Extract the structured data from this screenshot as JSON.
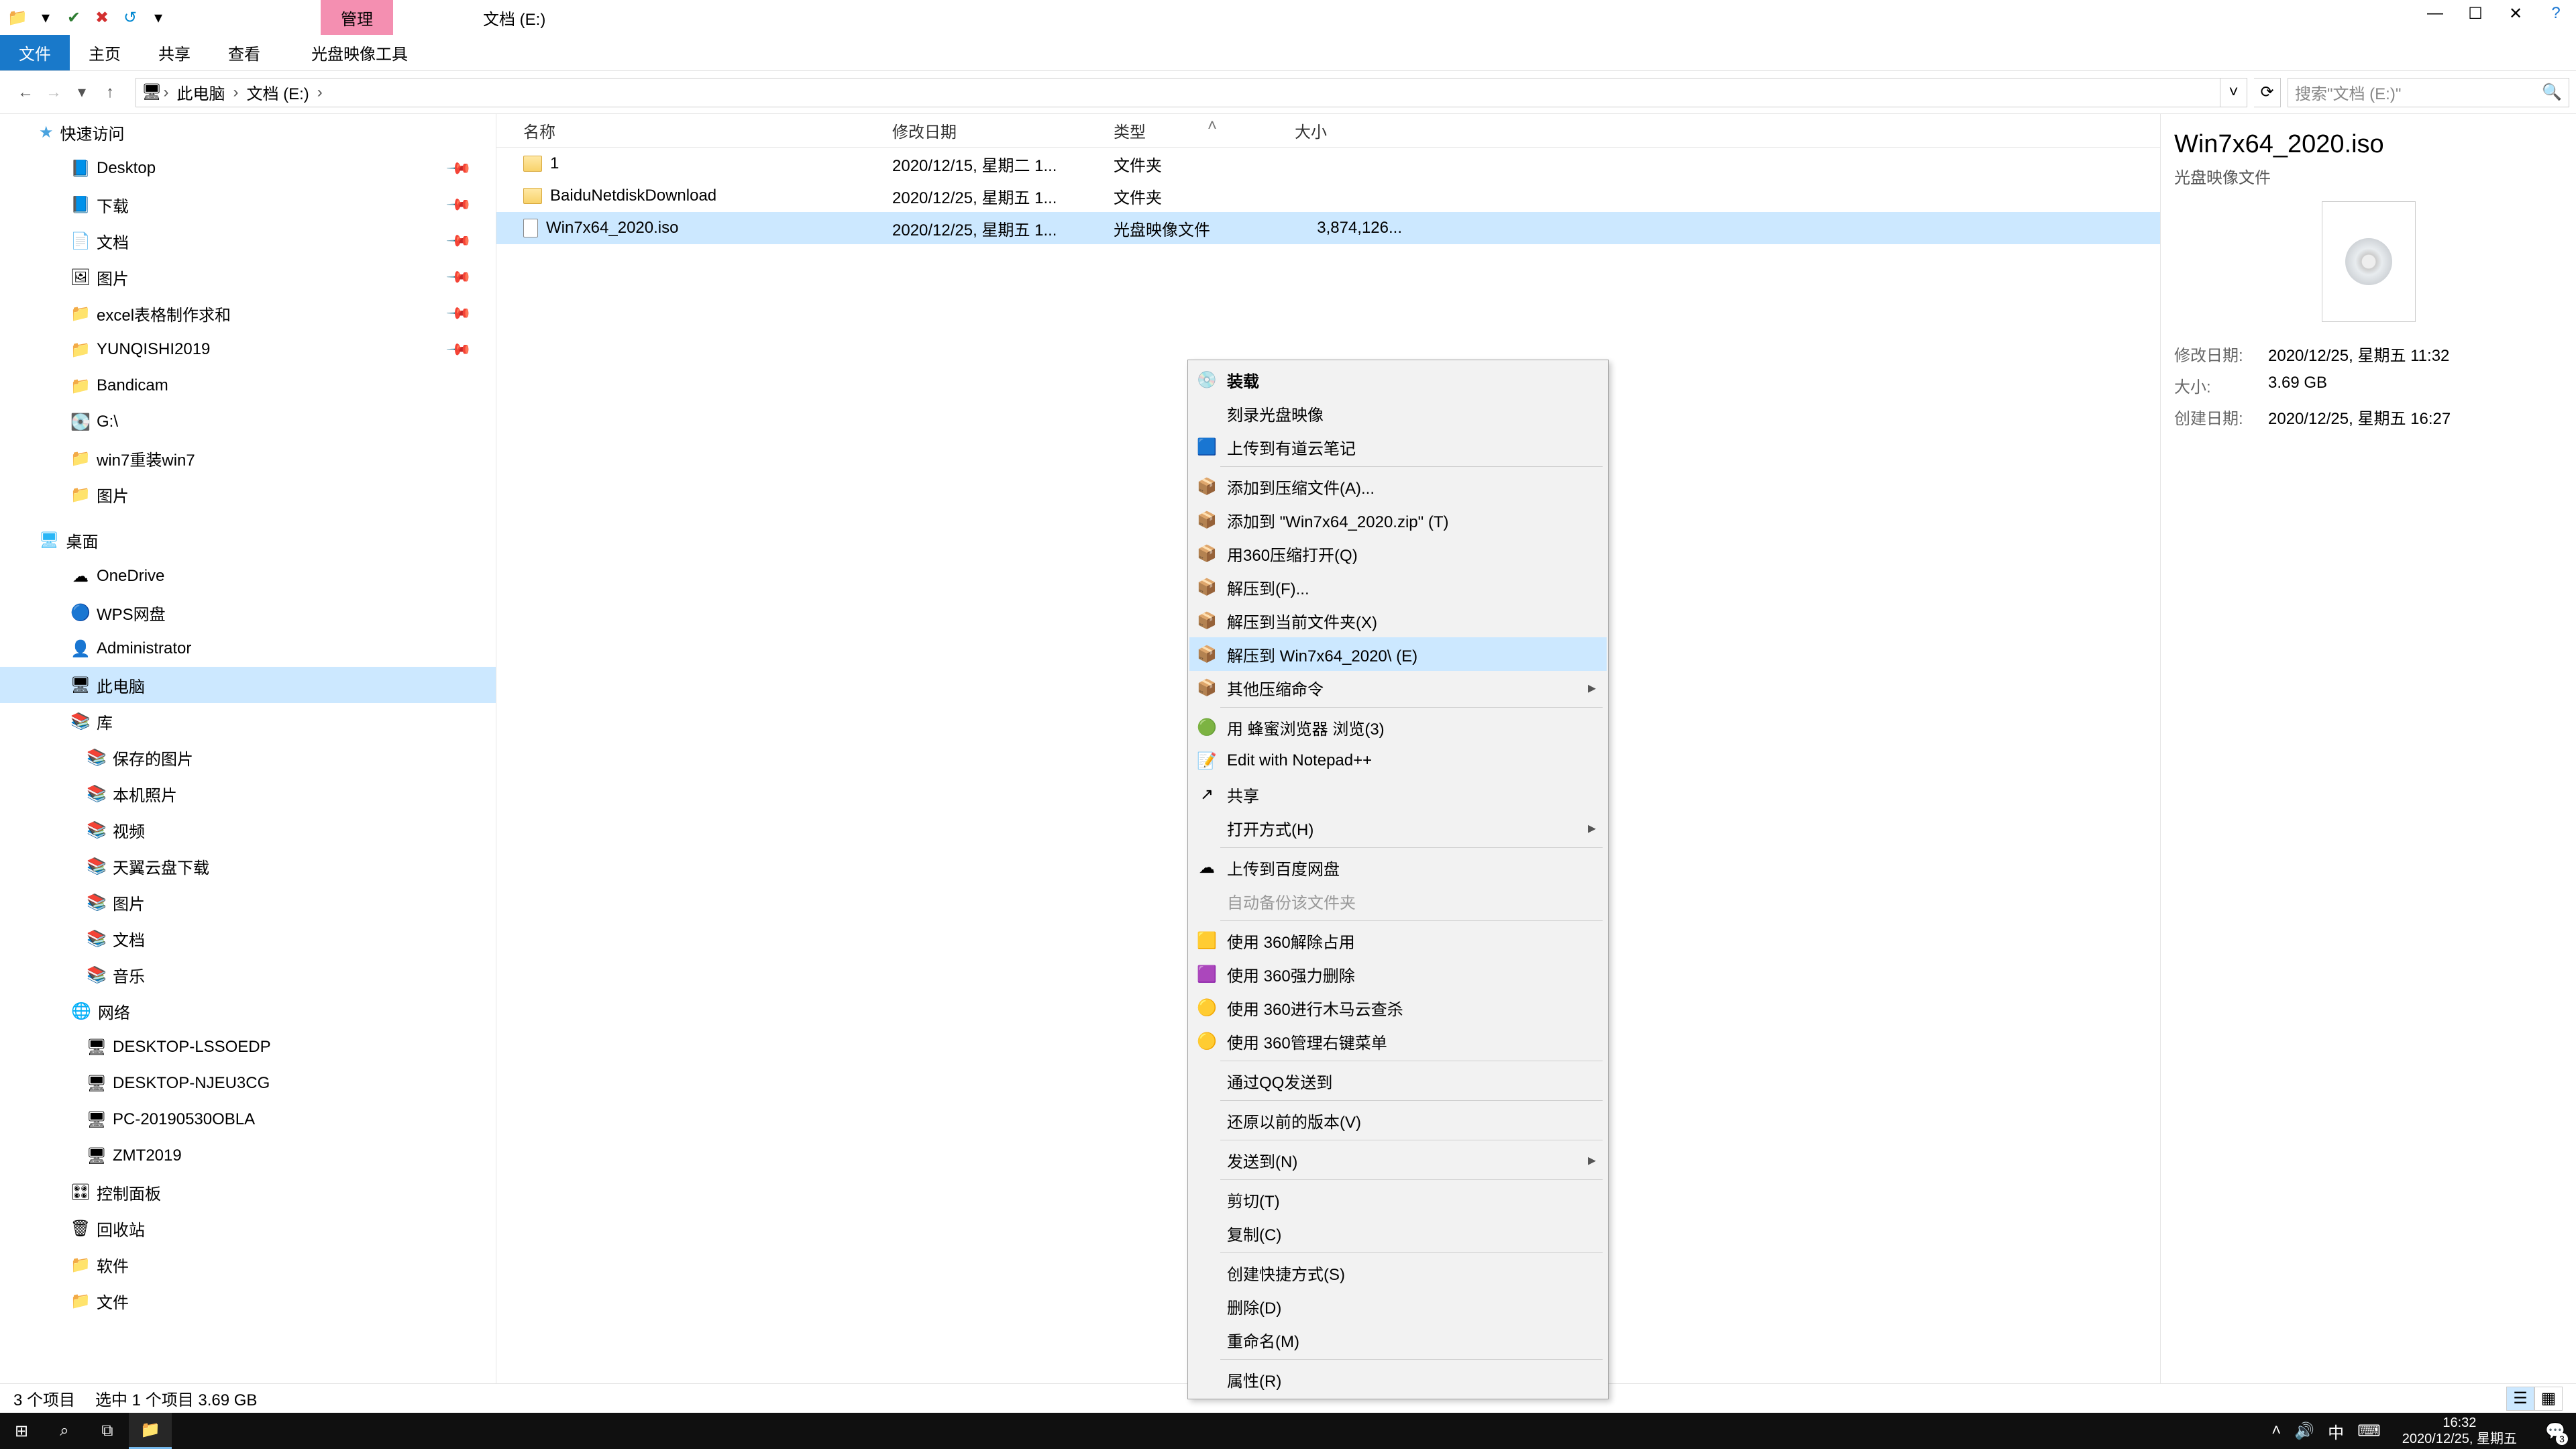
{
  "titlebar": {
    "contextTab": "管理",
    "windowTitle": "文档 (E:)"
  },
  "ribbon": {
    "tabs": [
      "文件",
      "主页",
      "共享",
      "查看",
      "光盘映像工具"
    ]
  },
  "address": {
    "crumbs": [
      "此电脑",
      "文档 (E:)"
    ],
    "searchPlaceholder": "搜索\"文档 (E:)\""
  },
  "nav": {
    "quickAccess": "快速访问",
    "quickItems": [
      {
        "label": "Desktop",
        "pin": true,
        "ic": "📘"
      },
      {
        "label": "下载",
        "pin": true,
        "ic": "📘"
      },
      {
        "label": "文档",
        "pin": true,
        "ic": "📄"
      },
      {
        "label": "图片",
        "pin": true,
        "ic": "🖼"
      },
      {
        "label": "excel表格制作求和",
        "pin": true,
        "ic": "📁"
      },
      {
        "label": "YUNQISHI2019",
        "pin": true,
        "ic": "📁"
      },
      {
        "label": "Bandicam",
        "pin": false,
        "ic": "📁"
      },
      {
        "label": "G:\\",
        "pin": false,
        "ic": "💽"
      },
      {
        "label": "win7重装win7",
        "pin": false,
        "ic": "📁"
      },
      {
        "label": "图片",
        "pin": false,
        "ic": "📁"
      }
    ],
    "desktop": "桌面",
    "desktopItems": [
      {
        "label": "OneDrive",
        "ic": "☁"
      },
      {
        "label": "WPS网盘",
        "ic": "🔵"
      },
      {
        "label": "Administrator",
        "ic": "👤"
      },
      {
        "label": "此电脑",
        "ic": "🖥",
        "selected": true
      },
      {
        "label": "库",
        "ic": "📚"
      }
    ],
    "libraryItems": [
      {
        "label": "保存的图片"
      },
      {
        "label": "本机照片"
      },
      {
        "label": "视频"
      },
      {
        "label": "天翼云盘下载"
      },
      {
        "label": "图片"
      },
      {
        "label": "文档"
      },
      {
        "label": "音乐"
      }
    ],
    "network": "网络",
    "networkItems": [
      {
        "label": "DESKTOP-LSSOEDP"
      },
      {
        "label": "DESKTOP-NJEU3CG"
      },
      {
        "label": "PC-20190530OBLA"
      },
      {
        "label": "ZMT2019"
      }
    ],
    "extras": [
      {
        "label": "控制面板",
        "ic": "🎛"
      },
      {
        "label": "回收站",
        "ic": "🗑"
      },
      {
        "label": "软件",
        "ic": "📁"
      },
      {
        "label": "文件",
        "ic": "📁"
      }
    ]
  },
  "columns": {
    "name": "名称",
    "date": "修改日期",
    "type": "类型",
    "size": "大小"
  },
  "files": [
    {
      "name": "1",
      "date": "2020/12/15, 星期二 1...",
      "type": "文件夹",
      "size": "",
      "ic": "folder"
    },
    {
      "name": "BaiduNetdiskDownload",
      "date": "2020/12/25, 星期五 1...",
      "type": "文件夹",
      "size": "",
      "ic": "folder"
    },
    {
      "name": "Win7x64_2020.iso",
      "date": "2020/12/25, 星期五 1...",
      "type": "光盘映像文件",
      "size": "3,874,126...",
      "ic": "file",
      "selected": true
    }
  ],
  "context": {
    "groups": [
      [
        {
          "label": "装载",
          "ic": "💿",
          "bold": true
        },
        {
          "label": "刻录光盘映像"
        },
        {
          "label": "上传到有道云笔记",
          "ic": "🟦"
        }
      ],
      [
        {
          "label": "添加到压缩文件(A)...",
          "ic": "📦"
        },
        {
          "label": "添加到 \"Win7x64_2020.zip\" (T)",
          "ic": "📦"
        },
        {
          "label": "用360压缩打开(Q)",
          "ic": "📦"
        },
        {
          "label": "解压到(F)...",
          "ic": "📦"
        },
        {
          "label": "解压到当前文件夹(X)",
          "ic": "📦"
        },
        {
          "label": "解压到 Win7x64_2020\\ (E)",
          "ic": "📦",
          "hover": true
        },
        {
          "label": "其他压缩命令",
          "ic": "📦",
          "sub": true
        }
      ],
      [
        {
          "label": "用 蜂蜜浏览器 浏览(3)",
          "ic": "🟢"
        },
        {
          "label": "Edit with Notepad++",
          "ic": "📝"
        },
        {
          "label": "共享",
          "ic": "↗"
        },
        {
          "label": "打开方式(H)",
          "sub": true
        }
      ],
      [
        {
          "label": "上传到百度网盘",
          "ic": "☁"
        },
        {
          "label": "自动备份该文件夹",
          "disabled": true
        }
      ],
      [
        {
          "label": "使用 360解除占用",
          "ic": "🟨"
        },
        {
          "label": "使用 360强力删除",
          "ic": "🟪"
        },
        {
          "label": "使用 360进行木马云查杀",
          "ic": "🟡"
        },
        {
          "label": "使用 360管理右键菜单",
          "ic": "🟡"
        }
      ],
      [
        {
          "label": "通过QQ发送到"
        }
      ],
      [
        {
          "label": "还原以前的版本(V)"
        }
      ],
      [
        {
          "label": "发送到(N)",
          "sub": true
        }
      ],
      [
        {
          "label": "剪切(T)"
        },
        {
          "label": "复制(C)"
        }
      ],
      [
        {
          "label": "创建快捷方式(S)"
        },
        {
          "label": "删除(D)"
        },
        {
          "label": "重命名(M)"
        }
      ],
      [
        {
          "label": "属性(R)"
        }
      ]
    ]
  },
  "details": {
    "title": "Win7x64_2020.iso",
    "subtitle": "光盘映像文件",
    "rows": [
      {
        "label": "修改日期:",
        "value": "2020/12/25, 星期五 11:32"
      },
      {
        "label": "大小:",
        "value": "3.69 GB"
      },
      {
        "label": "创建日期:",
        "value": "2020/12/25, 星期五 16:27"
      }
    ]
  },
  "status": {
    "count": "3 个项目",
    "selected": "选中 1 个项目  3.69 GB"
  },
  "taskbar": {
    "time": "16:32",
    "date": "2020/12/25, 星期五",
    "ime": "中",
    "notifCount": "3"
  }
}
